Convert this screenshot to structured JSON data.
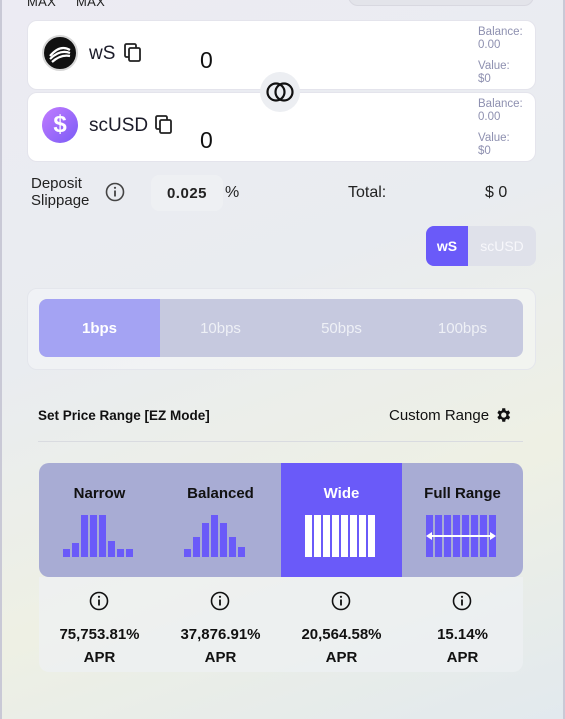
{
  "top": {
    "max_a": "MAX",
    "max_b": "MAX"
  },
  "tokens": [
    {
      "symbol": "wS",
      "amount": "0",
      "balance_label": "Balance:",
      "balance": "0.00",
      "value_label": "Value:",
      "value": "$0"
    },
    {
      "symbol": "scUSD",
      "amount": "0",
      "balance_label": "Balance:",
      "balance": "0.00",
      "value_label": "Value:",
      "value": "$0"
    }
  ],
  "slippage": {
    "label_line1": "Deposit",
    "label_line2": "Slippage",
    "value": "0.025",
    "unit": "%"
  },
  "total": {
    "label": "Total:",
    "value": "$ 0"
  },
  "token_toggle": {
    "options": [
      "wS",
      "scUSD"
    ],
    "selected": "wS"
  },
  "fee_tiers": {
    "options": [
      "1bps",
      "10bps",
      "50bps",
      "100bps"
    ],
    "selected": "1bps"
  },
  "range": {
    "title": "Set Price Range [EZ Mode]",
    "custom_label": "Custom Range",
    "modes": [
      {
        "label": "Narrow",
        "apr": "75,753.81%",
        "apr_unit": "APR"
      },
      {
        "label": "Balanced",
        "apr": "37,876.91%",
        "apr_unit": "APR"
      },
      {
        "label": "Wide",
        "apr": "20,564.58%",
        "apr_unit": "APR"
      },
      {
        "label": "Full Range",
        "apr": "15.14%",
        "apr_unit": "APR"
      }
    ],
    "selected": "Wide"
  },
  "colors": {
    "accent": "#6a5af9",
    "fee_selected": "#a4a3f3",
    "mode_bg": "#a8acd4",
    "muted_text": "#8e90b0"
  }
}
